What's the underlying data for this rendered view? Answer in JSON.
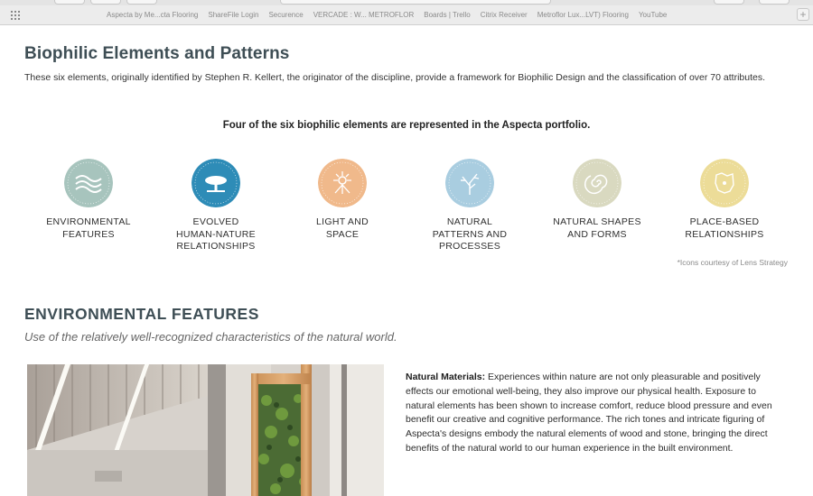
{
  "browser": {
    "bookmarks": [
      "Aspecta by Me...cta Flooring",
      "ShareFile Login",
      "Securence",
      "VERCADE : W... METROFLOR",
      "Boards | Trello",
      "Citrix Receiver",
      "Metroflor Lux...LVT) Flooring",
      "YouTube"
    ],
    "new_tab_label": "+"
  },
  "page": {
    "title": "Biophilic Elements and Patterns",
    "intro": "These six elements, originally identified by Stephen R. Kellert, the originator of the discipline, provide a framework for Biophilic Design and the classification of over 70 attributes.",
    "subhead": "Four of the six biophilic elements are represented in the Aspecta portfolio.",
    "elements": [
      {
        "label": "ENVIRONMENTAL\nFEATURES",
        "color": "#a7c4bd",
        "icon": "waves-icon"
      },
      {
        "label": "EVOLVED\nHUMAN-NATURE\nRELATIONSHIPS",
        "color": "#2e8cb7",
        "icon": "tree-icon"
      },
      {
        "label": "LIGHT AND\nSPACE",
        "color": "#f0b98b",
        "icon": "sun-icon"
      },
      {
        "label": "NATURAL\nPATTERNS AND\nPROCESSES",
        "color": "#a9cde0",
        "icon": "branch-icon"
      },
      {
        "label": "NATURAL SHAPES\nAND FORMS",
        "color": "#d9d9c0",
        "icon": "spiral-icon"
      },
      {
        "label": "PLACE-BASED\nRELATIONSHIPS",
        "color": "#ecdc98",
        "icon": "map-icon"
      }
    ],
    "credit": "*Icons courtesy of Lens Strategy",
    "section": {
      "title": "ENVIRONMENTAL FEATURES",
      "subtitle": "Use of the relatively well-recognized characteristics of the natural world.",
      "body_label": "Natural Materials:",
      "body_text": " Experiences within nature are not only pleasurable and positively effects our emotional well-being, they also improve our physical health. Exposure to natural elements has been shown to increase comfort, reduce blood pressure and even benefit our creative and cognitive performance. The rich tones and intricate figuring of Aspecta's designs embody the natural elements of wood and stone, bringing the direct benefits of the natural world to our human experience in the built environment."
    }
  }
}
